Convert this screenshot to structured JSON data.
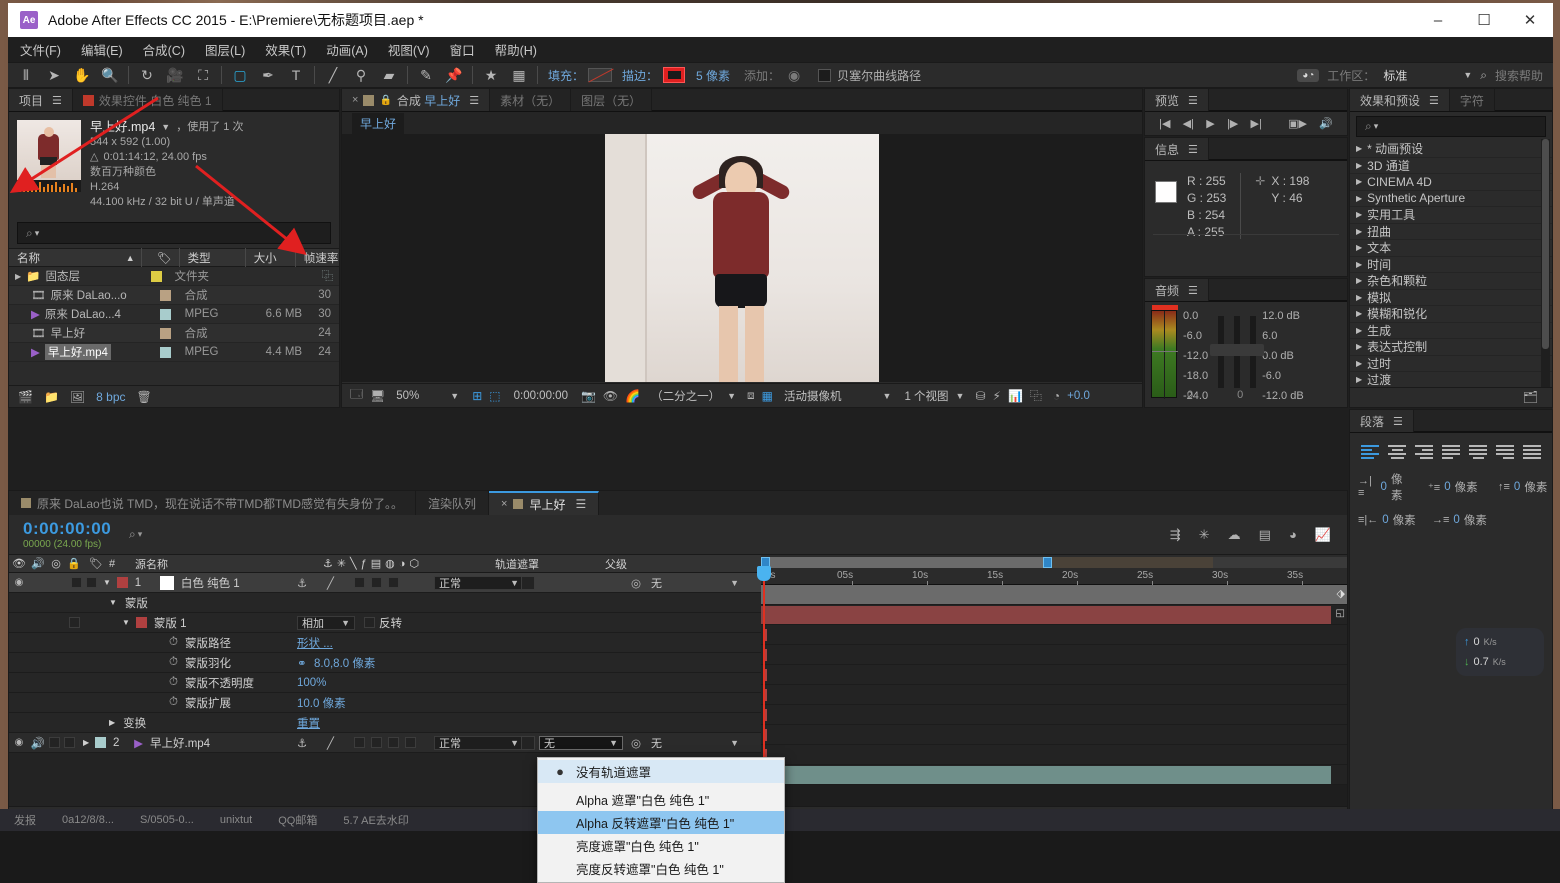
{
  "window": {
    "title": "Adobe After Effects CC 2015 - E:\\Premiere\\无标题项目.aep *",
    "logo": "Ae",
    "minimize": "–",
    "maximize": "☐",
    "close": "✕"
  },
  "menubar": [
    "文件(F)",
    "编辑(E)",
    "合成(C)",
    "图层(L)",
    "效果(T)",
    "动画(A)",
    "视图(V)",
    "窗口",
    "帮助(H)"
  ],
  "toolbar": {
    "icons": [
      "selection-tool",
      "hand-tool",
      "zoom-tool",
      "rotation-tool",
      "camera-tool",
      "pan-behind-tool",
      "shape-tool",
      "pen-tool",
      "text-tool",
      "brush-tool",
      "clone-stamp-tool",
      "eraser-tool",
      "roto-brush-tool",
      "puppet-pin-tool"
    ],
    "fill_label": "填充：",
    "stroke_label": "描边：",
    "stroke_width": "5 像素",
    "add_label": "添加：",
    "bezier_label": "贝塞尔曲线路径",
    "workspace_label": "工作区：",
    "workspace_value": "标准",
    "search_help": "搜索帮助"
  },
  "project_panel": {
    "tabs": [
      {
        "label": "项目",
        "active": true
      },
      {
        "label": "效果控件 白色 纯色 1",
        "active": false
      }
    ],
    "asset": {
      "name": "早上好.mp4",
      "usage": "，使用了 1 次",
      "dimensions": "544 x 592 (1.00)",
      "duration": "0:01:14:12, 24.00 fps",
      "colors": "数百万种颜色",
      "codec": "H.264",
      "audio": "44.100 kHz / 32 bit U / 单声道"
    },
    "search_placeholder": "",
    "columns": [
      "名称",
      "类型",
      "大小",
      "帧速率"
    ],
    "rows": [
      {
        "name": "固态层",
        "kind": "folder",
        "swatch": "#ddcc44",
        "type": "文件夹",
        "size": "",
        "fps": ""
      },
      {
        "name": "原来 DaLao...o",
        "kind": "comp",
        "swatch": "#b9a183",
        "type": "合成",
        "size": "",
        "fps": "30"
      },
      {
        "name": "原来 DaLao...4",
        "kind": "video",
        "swatch": "#a8cccc",
        "type": "MPEG",
        "size": "6.6 MB",
        "fps": "30"
      },
      {
        "name": "早上好",
        "kind": "comp",
        "swatch": "#b9a183",
        "type": "合成",
        "size": "",
        "fps": "24"
      },
      {
        "name": "早上好.mp4",
        "kind": "video",
        "swatch": "#a8cccc",
        "type": "MPEG",
        "size": "4.4 MB",
        "fps": "24",
        "selected": true
      }
    ],
    "footer_bpc": "8 bpc"
  },
  "comp_panel": {
    "tabs": [
      {
        "label": "合成 早上好",
        "active": true
      },
      {
        "label": "素材（无）",
        "active": false
      },
      {
        "label": "图层（无）",
        "active": false
      }
    ],
    "breadcrumb": "早上好",
    "toolbar": {
      "zoom": "50%",
      "timecode": "0:00:00:00",
      "resolution": "（二分之一）",
      "camera": "活动摄像机",
      "views": "1 个视图",
      "exposure": "+0.0"
    }
  },
  "preview_panel": {
    "title": "预览",
    "buttons": [
      "first-frame",
      "prev-frame",
      "play",
      "next-frame",
      "last-frame",
      "ram-preview",
      "audio-toggle"
    ]
  },
  "info_panel": {
    "title": "信息",
    "r": "R : 255",
    "g": "G : 253",
    "b": "B : 254",
    "a": "A : 255",
    "x": "X : 198",
    "y": "Y : 46"
  },
  "audio_panel": {
    "title": "音频",
    "scale": [
      "0.0",
      "-6.0",
      "-12.0",
      "-18.0",
      "-24.0"
    ],
    "db_right": [
      "12.0 dB",
      "6.0",
      "0.0 dB",
      "-6.0",
      "-12.0 dB"
    ],
    "values": [
      "0",
      "0"
    ]
  },
  "effects_panel": {
    "tabs": [
      {
        "label": "效果和预设",
        "active": true
      },
      {
        "label": "字符",
        "active": false
      }
    ],
    "items": [
      "* 动画预设",
      "3D 通道",
      "CINEMA 4D",
      "Synthetic Aperture",
      "实用工具",
      "扭曲",
      "文本",
      "时间",
      "杂色和颗粒",
      "模拟",
      "模糊和锐化",
      "生成",
      "表达式控制",
      "过时",
      "过渡"
    ]
  },
  "paragraph_panel": {
    "title": "段落",
    "align_icons": [
      "align-left",
      "align-center",
      "align-right",
      "justify-last-left",
      "justify-last-center",
      "justify-last-right",
      "justify-all"
    ],
    "indents": [
      {
        "glyph": "→|≡",
        "value": "0",
        "unit": "像素"
      },
      {
        "glyph": "⁺≡",
        "value": "0",
        "unit": "像素"
      },
      {
        "glyph": "↑≡",
        "value": "0",
        "unit": "像素"
      },
      {
        "glyph": "≡|←",
        "value": "0",
        "unit": "像素"
      },
      {
        "glyph": "→≡",
        "value": "0",
        "unit": "像素"
      }
    ]
  },
  "network_widget": {
    "upload": "0",
    "upload_unit": "K/s",
    "download": "0.7",
    "download_unit": "K/s"
  },
  "timeline": {
    "tabs": [
      {
        "label": "原来 DaLao也说 TMD，现在说话不带TMD都TMD感觉有失身份了。。",
        "active": false
      },
      {
        "label": "渲染队列",
        "active": false
      },
      {
        "label": "早上好",
        "active": true
      }
    ],
    "current_time": "0:00:00:00",
    "frame_info": "00000 (24.00 fps)",
    "columns": {
      "source_name": "源名称",
      "number": "#",
      "track_matte": "轨道遮罩",
      "parent": "父级"
    },
    "ruler_ticks": [
      "0s",
      "05s",
      "10s",
      "15s",
      "20s",
      "25s",
      "30s",
      "35s"
    ],
    "layers": [
      {
        "index": "1",
        "name": "白色 纯色 1",
        "mode": "正常",
        "parent": "无",
        "color": "#b04040",
        "selected": true
      },
      {
        "index": "2",
        "name": "早上好.mp4",
        "mode": "正常",
        "matte": "无",
        "parent": "无",
        "color": "#a8cccc",
        "selected": false
      }
    ],
    "mask_group": "蒙版",
    "mask_name": "蒙版 1",
    "mask_mode": "相加",
    "mask_invert": "反转",
    "properties": [
      {
        "label": "蒙版路径",
        "value": "形状 ..."
      },
      {
        "label": "蒙版羽化",
        "value": "8.0,8.0 像素"
      },
      {
        "label": "蒙版不透明度",
        "value": "100%"
      },
      {
        "label": "蒙版扩展",
        "value": "10.0 像素"
      }
    ],
    "transform_label": "变换",
    "transform_value": "重置"
  },
  "track_matte_menu": {
    "items": [
      {
        "label": "没有轨道遮罩",
        "bullet": true,
        "highlighted": false
      },
      {
        "label": "Alpha 遮罩\"白色 纯色 1\"",
        "bullet": false,
        "highlighted": false
      },
      {
        "label": "Alpha 反转遮罩\"白色 纯色 1\"",
        "bullet": false,
        "highlighted": true
      },
      {
        "label": "亮度遮罩\"白色 纯色 1\"",
        "bullet": false,
        "highlighted": false
      },
      {
        "label": "亮度反转遮罩\"白色 纯色 1\"",
        "bullet": false,
        "highlighted": false
      }
    ]
  },
  "taskbar": [
    "发报",
    "0a12/8/8...",
    "S/0505-0...",
    "unixtut",
    "QQ邮箱",
    "5.7 AE去水印"
  ],
  "colors": {
    "accent_blue": "#3c9ae0",
    "link_blue": "#6fa8dc",
    "red": "#e02020",
    "panel_bg": "#2b2b2b"
  }
}
